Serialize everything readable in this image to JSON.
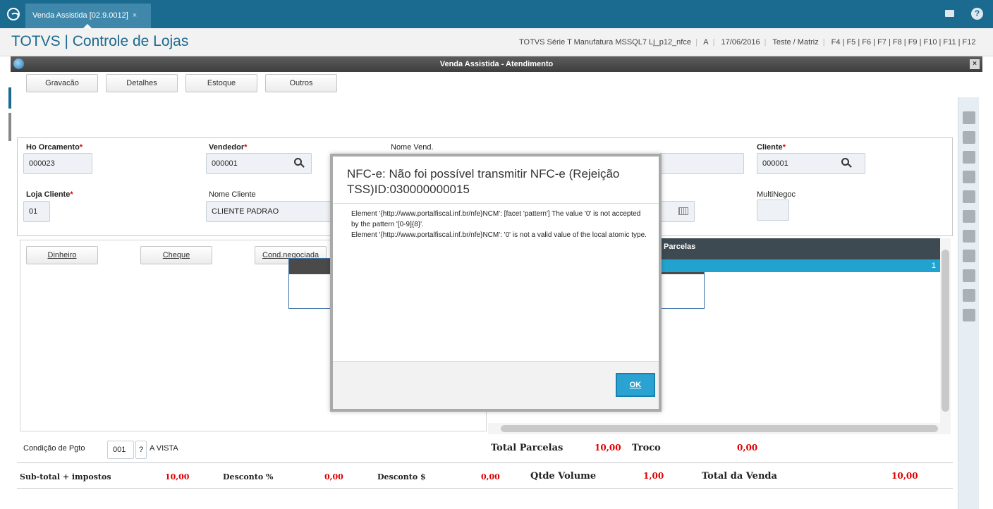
{
  "tabbar": {
    "tab_label": "Venda Assistida [02.9.0012]",
    "tab_close": "×"
  },
  "header": {
    "brand": "TOTVS | Controle de Lojas",
    "environment": "TOTVS Série T Manufatura MSSQL7 Lj_p12_nfce",
    "mode": "A",
    "date": "17/06/2016",
    "company": "Teste / Matriz",
    "shortcuts": "F4 | F5 | F6 | F7 | F8 | F9 | F10 | F11 | F12"
  },
  "window": {
    "title": "Venda Assistida - Atendimento",
    "close": "×"
  },
  "toolbar": {
    "gravacao": "Gravacão",
    "detalhes": "Detalhes",
    "estoque": "Estoque",
    "outros": "Outros"
  },
  "form": {
    "orcamento_label": "Ho Orcamento",
    "orcamento_value": "000023",
    "vendedor_label": "Vendedor",
    "vendedor_value": "000001",
    "nome_vend_label": "Nome Vend.",
    "cliente_label": "Cliente",
    "cliente_value": "000001",
    "loja_label": "Loja Cliente",
    "loja_value": "01",
    "nome_cliente_label": "Nome Cliente",
    "nome_cliente_value": "CLIENTE PADRAO",
    "multinegoc_label": "MultiNegoc",
    "required_mark": "*"
  },
  "payment": {
    "dinheiro": "Dinheiro",
    "cheque": "Cheque",
    "cond_negociada": "Cond.negociada",
    "parcelas_header": "Parcelas",
    "row_value": "1",
    "cond_pgto_label": "Condição de Pgto",
    "cond_pgto_code": "001",
    "cond_pgto_help": "?",
    "cond_pgto_desc": "A VISTA",
    "total_parcelas_label": "Total Parcelas",
    "total_parcelas_value": "10,00",
    "troco_label": "Troco",
    "troco_value": "0,00"
  },
  "totals": {
    "subtotal_label": "Sub-total + impostos",
    "subtotal_value": "10,00",
    "desconto_pct_label": "Desconto %",
    "desconto_pct_value": "0,00",
    "desconto_val_label": "Desconto $",
    "desconto_val_value": "0,00",
    "qtde_volume_label": "Qtde Volume",
    "qtde_volume_value": "1,00",
    "total_venda_label": "Total da Venda",
    "total_venda_value": "10,00"
  },
  "modal": {
    "title": "NFC-e: Não foi possível transmitir NFC-e (Rejeição TSS)ID:030000000015",
    "line1": "Element '{http://www.portalfiscal.inf.br/nfe}NCM': [facet 'pattern'] The value '0' is not accepted by the pattern '[0-9]{8}'.",
    "line2": "Element '{http://www.portalfiscal.inf.br/nfe}NCM': '0' is not a valid value of the local atomic type.",
    "ok": "OK"
  },
  "colors": {
    "topbar": "#1b6a8f",
    "brand": "#1b6a8f",
    "required": "#e00000",
    "ok_button": "#2aa3d3",
    "grid_selected": "#22a3cf"
  }
}
